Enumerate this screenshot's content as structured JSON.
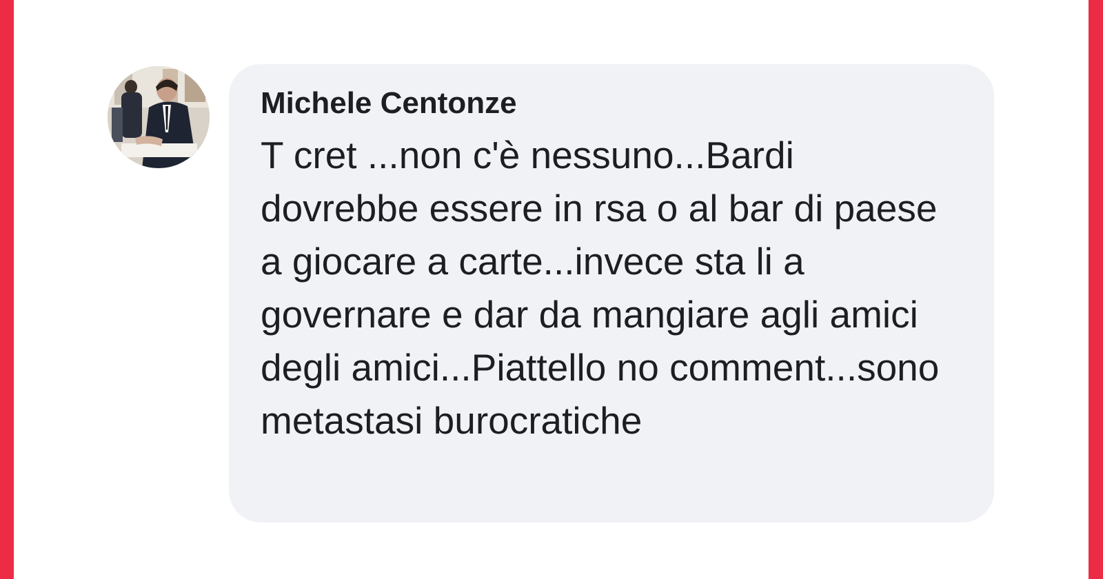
{
  "comment": {
    "author": "Michele Centonze",
    "text": "T cret ...non c'è nessuno...Bardi dovrebbe essere in rsa o al bar di paese a giocare a carte...invece sta li a governare e dar da mangiare agli amici degli amici...Piattello no comment...sono metastasi burocratiche"
  },
  "colors": {
    "frame": "#ec2c44",
    "bubble": "#f0f2f5",
    "text": "#1c1e21"
  },
  "icons": {
    "avatar": "profile-photo"
  }
}
